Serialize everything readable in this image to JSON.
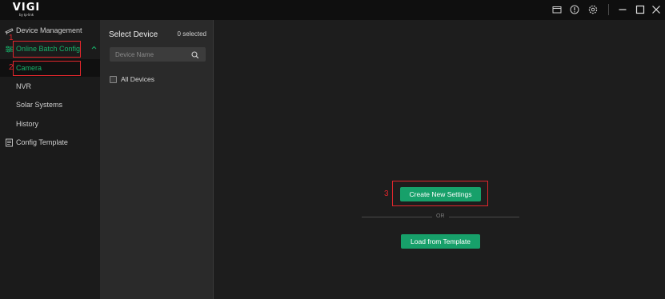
{
  "app": {
    "logo": "VIGI",
    "logo_sub": "by tp-link"
  },
  "titlebar": {
    "icons": [
      "folder-icon",
      "info-icon",
      "settings-icon",
      "minimize-icon",
      "maximize-icon",
      "close-icon"
    ]
  },
  "sidebar": {
    "items": [
      {
        "label": "Device Management",
        "icon": "device-icon"
      },
      {
        "label": "Online Batch Config",
        "icon": "batch-config-icon",
        "expanded": true
      },
      {
        "label": "Camera",
        "active": true
      },
      {
        "label": "NVR"
      },
      {
        "label": "Solar Systems"
      },
      {
        "label": "History"
      },
      {
        "label": "Config Template",
        "icon": "template-icon"
      }
    ]
  },
  "device_panel": {
    "title": "Select Device",
    "selected": "0 selected",
    "search_placeholder": "Device Name",
    "all_devices": "All Devices",
    "all_devices_checked": false
  },
  "main": {
    "create_button": "Create New Settings",
    "or_text": "OR",
    "load_button": "Load from Template"
  },
  "annotations": [
    "1",
    "2",
    "3"
  ],
  "colors": {
    "accent": "#17a06a",
    "annotation": "#e0262c",
    "active_text": "#17b26a"
  }
}
